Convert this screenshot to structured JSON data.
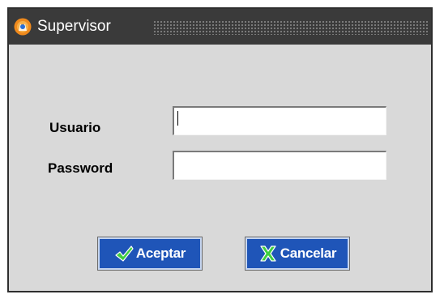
{
  "window": {
    "title": "Supervisor",
    "title_icon": "app-logo-icon"
  },
  "form": {
    "usuario_label": "Usuario",
    "usuario_value": "",
    "password_label": "Password",
    "password_value": ""
  },
  "buttons": {
    "accept_label": "Aceptar",
    "accept_icon": "checkmark-icon",
    "cancel_label": "Cancelar",
    "cancel_icon": "x-mark-icon"
  },
  "colors": {
    "titlebar": "#3a3a3a",
    "window_bg": "#d9d9d9",
    "button_bg": "#1f55b8",
    "checkmark": "#3fcf3f",
    "cancel_mark": "#3fcf3f"
  }
}
